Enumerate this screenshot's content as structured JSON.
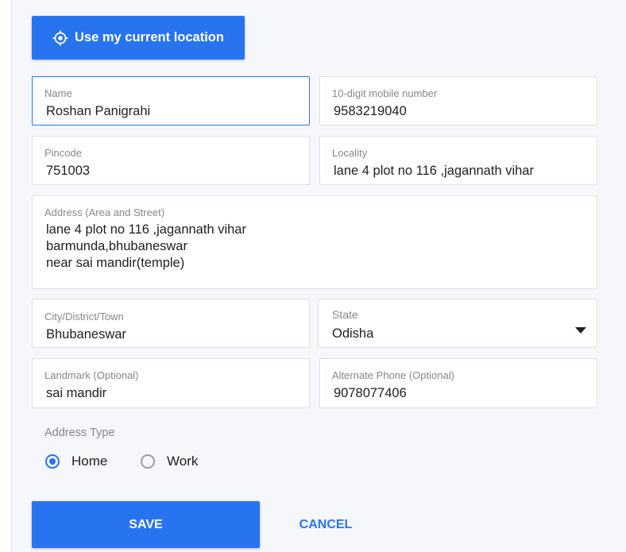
{
  "location_button": {
    "label": "Use my current location",
    "icon": "crosshair-icon"
  },
  "fields": {
    "name": {
      "label": "Name",
      "value": "Roshan Panigrahi"
    },
    "mobile": {
      "label": "10-digit mobile number",
      "value": "9583219040"
    },
    "pincode": {
      "label": "Pincode",
      "value": "751003"
    },
    "locality": {
      "label": "Locality",
      "value": "lane 4 plot no 116 ,jagannath vihar"
    },
    "address": {
      "label": "Address (Area and Street)",
      "value": "lane 4 plot no 116 ,jagannath vihar\nbarmunda,bhubaneswar\nnear sai mandir(temple)"
    },
    "city": {
      "label": "City/District/Town",
      "value": "Bhubaneswar"
    },
    "state": {
      "label": "State",
      "value": "Odisha"
    },
    "landmark": {
      "label": "Landmark (Optional)",
      "value": "sai mandir"
    },
    "alt_phone": {
      "label": "Alternate Phone (Optional)",
      "value": "9078077406"
    }
  },
  "address_type": {
    "label": "Address Type",
    "options": [
      {
        "label": "Home",
        "selected": true
      },
      {
        "label": "Work",
        "selected": false
      }
    ]
  },
  "actions": {
    "save": "SAVE",
    "cancel": "CANCEL"
  },
  "colors": {
    "accent": "#2874f0",
    "label": "#878787",
    "text": "#212121"
  }
}
